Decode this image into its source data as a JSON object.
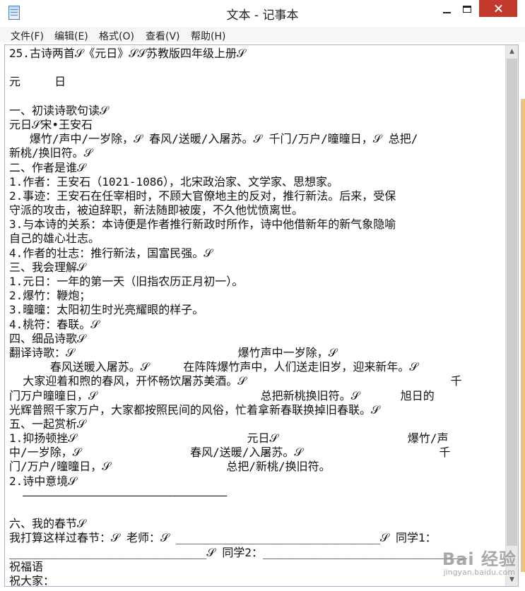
{
  "window": {
    "title": "文本 - 记事本",
    "icon": "notepad-icon",
    "controls": [
      "minimize-icon",
      "maximize-icon",
      "close-icon"
    ]
  },
  "menu": {
    "items": [
      "文件(F)",
      "编辑(E)",
      "格式(O)",
      "查看(V)",
      "帮助(H)"
    ]
  },
  "document": {
    "lines": [
      "25.古诗两首𝒮《元日》𝒮𝒮苏教版四年级上册𝒮",
      "",
      "元     日",
      "",
      "一、初读诗歌句读𝒮",
      "元日𝒮宋•王安石",
      "   爆竹/声中/一岁除，𝒮 春风/送暖/入屠苏。𝒮 千门/万户/曈曈日，𝒮 总把/",
      "新桃/换旧符。𝒮",
      "二、作者是谁𝒮",
      "1.作者：王安石（1021-1086），北宋政治家、文学家、思想家。",
      "2.事迹：王安石在任宰相时，不顾大官僚地主的反对，推行新法。后来，受保",
      "守派的攻击，被迫辞职，新法随即被废，不久他忧愤离世。",
      "3.与本诗的关系：本诗便是作者推行新政时所作，诗中他借新年的新气象隐喻",
      "自己的雄心壮志。",
      "4.作者的壮志：推行新法，国富民强。𝒮",
      "三、我会理解𝒮",
      "1.元日：一年的第一天（旧指农历正月初一）。",
      "2.爆竹：鞭炮；",
      "3.曈曈：太阳初生时光亮耀眼的样子。",
      "4.桃符：春联。𝒮",
      "四、细品诗歌𝒮",
      "翻译诗歌：𝒮                        爆竹声中一岁除，𝒮",
      "      春风送暖入屠苏。𝒮     在阵阵爆竹声中，人们送走旧岁，迎来新年。𝒮",
      "  大家迎着和煦的春风，开怀畅饮屠苏美酒。𝒮                              千",
      "门万户曈曈日，𝒮                        总把新桃换旧符。𝒮      旭日的",
      "光辉普照千家万户，大家都按照民间的风俗，忙着拿新春联换掉旧春联。𝒮",
      "五、一起赏析𝒮",
      "1.抑扬顿挫𝒮                         元日𝒮                   爆竹/声",
      "中/一岁除，𝒮                春风/送暖/入屠苏。𝒮                    千",
      "门/万户/曈曈日，𝒮                 总把/新桃/换旧符。",
      "2.诗中意境𝒮",
      "  ——————————————————————————————",
      "",
      "六、我的春节𝒮",
      "我打算这样过春节：𝒮 老师：𝒮 ______________________________𝒮 同学1：",
      "_____________________________𝒮 同学2：______________________________",
      "祝福语",
      "祝大家："
    ]
  },
  "watermark": {
    "main": "Bai 经验",
    "sub": "jingyan.baidu.com"
  }
}
